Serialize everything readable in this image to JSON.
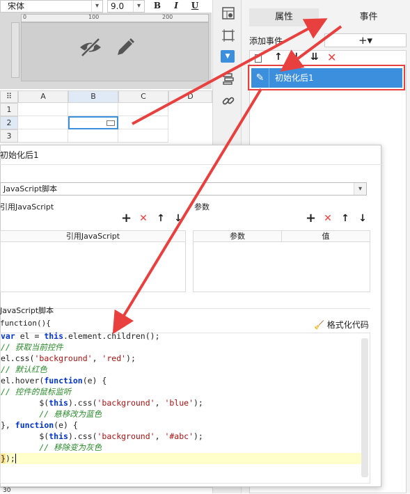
{
  "toolbar": {
    "font_name": "宋体",
    "font_size": "9.0",
    "bold": "B",
    "italic": "I",
    "underline": "U"
  },
  "preview": {
    "ruler_ticks": [
      "0",
      "100",
      "200"
    ]
  },
  "grid": {
    "columns": [
      "A",
      "B",
      "C",
      "D"
    ],
    "rows": [
      "1",
      "2",
      "3"
    ],
    "bottom_row": "30"
  },
  "right_panel": {
    "tab_properties": "属性",
    "tab_events": "事件",
    "add_event_label": "添加事件",
    "add_event_button": "+▾",
    "event_item": "初始化后1"
  },
  "dialog": {
    "title": "初始化后1",
    "type_value": "JavaScript脚本",
    "ref_js_label": "引用JavaScript",
    "params_label": "参数",
    "ref_js_col": "引用JavaScript",
    "params_col_name": "参数",
    "params_col_value": "值",
    "script_label": "JavaScript脚本",
    "function_sig": "function(){",
    "format_code": "格式化代码"
  },
  "code_lines": [
    "var el = this.element.children();",
    "// 获取当前控件",
    "el.css('background', 'red');",
    "// 默认红色",
    "el.hover(function(e) {",
    "// 控件的鼠标监听",
    "        $(this).css('background', 'blue');",
    "        // 悬移改为蓝色",
    "}, function(e) {",
    "        $(this).css('background', '#abc');",
    "        // 移除变为灰色",
    "});"
  ],
  "colors": {
    "accent_blue": "#3c8fdc",
    "annotation_red": "#e8403e",
    "delete_red": "#e8403e",
    "current_line": "#ffffcc"
  }
}
